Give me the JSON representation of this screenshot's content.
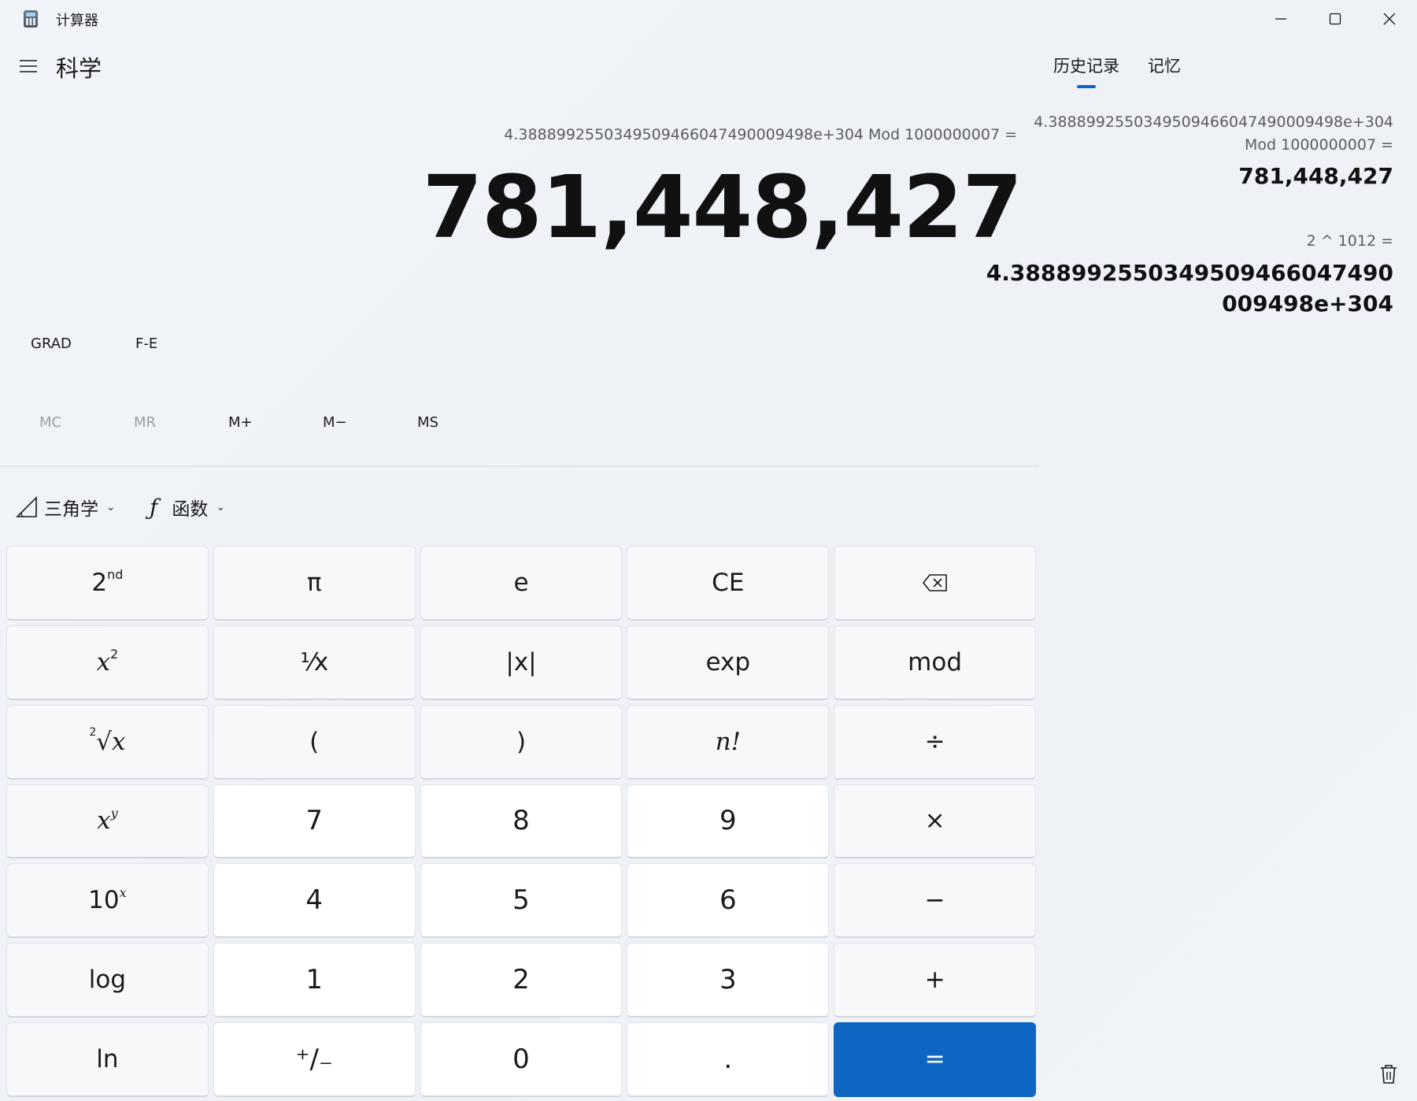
{
  "window": {
    "title": "计算器"
  },
  "header": {
    "mode_title": "科学"
  },
  "display": {
    "expression": "4.3888992550349509466047490009498e+304 Mod 1000000007 =",
    "result": "781,448,427"
  },
  "modes": {
    "angle": "GRAD",
    "fe": "F-E"
  },
  "memory": {
    "mc": "MC",
    "mr": "MR",
    "mplus": "M+",
    "mminus": "M−",
    "ms": "MS"
  },
  "dropdowns": {
    "trig": "三角学",
    "func": "函数"
  },
  "keys": {
    "second": "2",
    "second_sup": "nd",
    "pi": "π",
    "e": "e",
    "ce": "CE",
    "reciprocal": "⅟x",
    "abs": "|x|",
    "exp": "exp",
    "mod": "mod",
    "open_paren": "(",
    "close_paren": ")",
    "factorial": "n!",
    "divide": "÷",
    "seven": "7",
    "eight": "8",
    "nine": "9",
    "multiply": "×",
    "ten_base": "10",
    "four": "4",
    "five": "5",
    "six": "6",
    "minus": "−",
    "log": "log",
    "one": "1",
    "two": "2",
    "three": "3",
    "plus": "+",
    "ln": "ln",
    "negate": "⁺∕₋",
    "zero": "0",
    "decimal": ".",
    "equals": "="
  },
  "side_panel": {
    "tabs": [
      "历史记录",
      "记忆"
    ],
    "history": [
      {
        "expr_line1": "4.3888992550349509466047490009498e+304",
        "expr_line2": "Mod   1000000007 =",
        "result": "781,448,427"
      },
      {
        "expr_line1": "2   ^   1012 =",
        "result_line1": "4.3888992550349509466047490",
        "result_line2": "009498e+304"
      }
    ]
  },
  "colors": {
    "accent": "#0f66c2",
    "background": "#f1f4f8"
  }
}
